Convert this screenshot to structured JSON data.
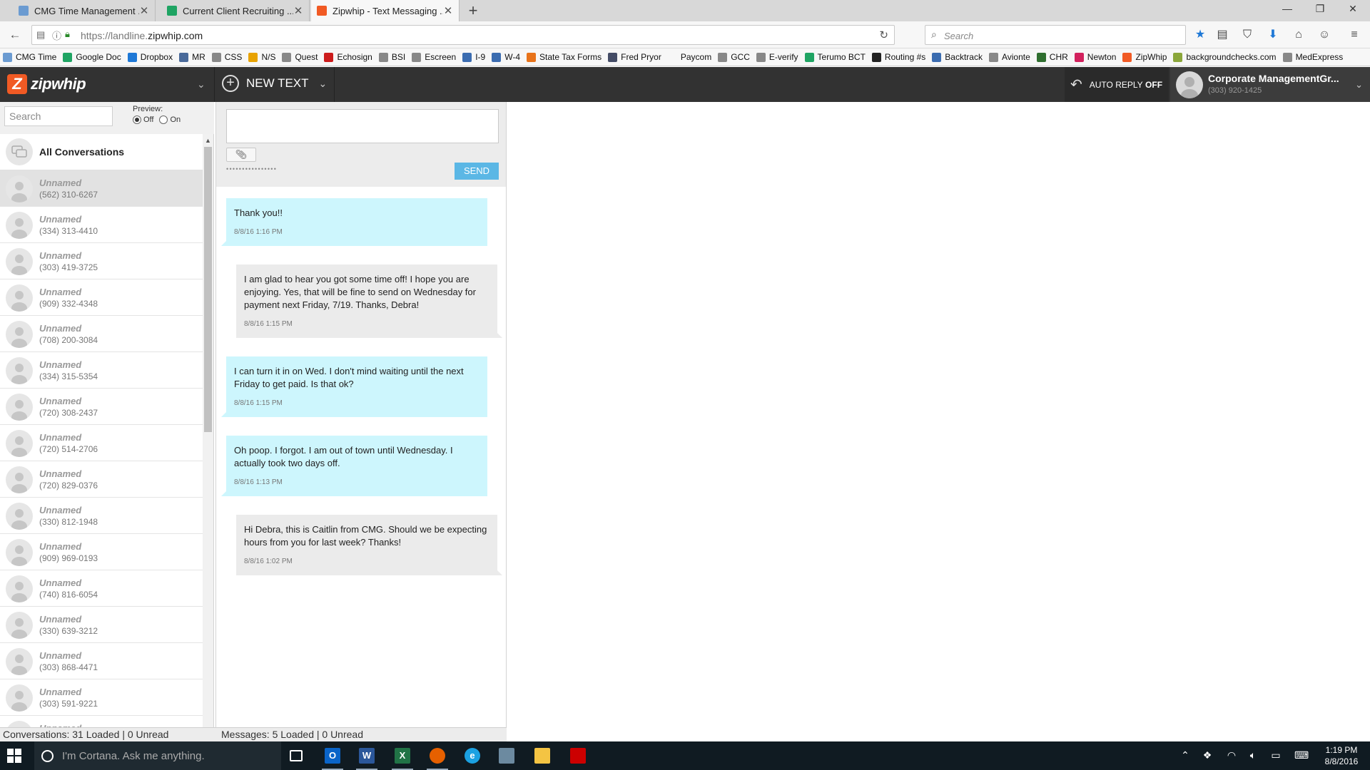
{
  "browser": {
    "tabs": [
      {
        "label": "CMG Time Management ...",
        "color": "#6b9bd1",
        "active": false
      },
      {
        "label": "Current Client Recruiting ...",
        "color": "#1fa463",
        "active": false
      },
      {
        "label": "Zipwhip - Text Messaging ...",
        "color": "#f15a24",
        "active": true
      }
    ],
    "url_prefix": "https://landline.",
    "url_domain": "zipwhip.com",
    "search_placeholder": "Search",
    "bookmarks": [
      {
        "label": "CMG Time",
        "color": "#6b9bd1"
      },
      {
        "label": "Google Doc",
        "color": "#1fa463"
      },
      {
        "label": "Dropbox",
        "color": "#1e78d6"
      },
      {
        "label": "MR",
        "color": "#4a6a9a"
      },
      {
        "label": "CSS",
        "color": "#888888"
      },
      {
        "label": "N/S",
        "color": "#e8a200"
      },
      {
        "label": "Quest",
        "color": "#888888"
      },
      {
        "label": "Echosign",
        "color": "#cc1c1c"
      },
      {
        "label": "BSI",
        "color": "#888888"
      },
      {
        "label": "Escreen",
        "color": "#888888"
      },
      {
        "label": "I-9",
        "color": "#3b6cb0"
      },
      {
        "label": "W-4",
        "color": "#3b6cb0"
      },
      {
        "label": "State Tax Forms",
        "color": "#e8731a"
      },
      {
        "label": "Fred Pryor",
        "color": "#444c66"
      },
      {
        "label": "Paycom",
        "color": "#f7f7f7"
      },
      {
        "label": "GCC",
        "color": "#888888"
      },
      {
        "label": "E-verify",
        "color": "#888888"
      },
      {
        "label": "Terumo BCT",
        "color": "#1fa463"
      },
      {
        "label": "Routing #s",
        "color": "#222222"
      },
      {
        "label": "Backtrack",
        "color": "#3b6cb0"
      },
      {
        "label": "Avionte",
        "color": "#888888"
      },
      {
        "label": "CHR",
        "color": "#2f6e2f"
      },
      {
        "label": "Newton",
        "color": "#d2215d"
      },
      {
        "label": "ZipWhip",
        "color": "#f15a24"
      },
      {
        "label": "backgroundchecks.com",
        "color": "#8aa63a"
      },
      {
        "label": "MedExpress",
        "color": "#888888"
      }
    ]
  },
  "app": {
    "brand": "zipwhip",
    "new_text_label": "NEW TEXT",
    "auto_reply_label": "AUTO REPLY",
    "auto_reply_state": "OFF",
    "account_name": "Corporate ManagementGr...",
    "account_phone": "(303) 920-1425"
  },
  "sidebar": {
    "search_placeholder": "Search",
    "preview_label": "Preview:",
    "preview_off": "Off",
    "preview_on": "On",
    "all_conversations": "All Conversations",
    "conversations": [
      {
        "name": "Unnamed",
        "phone": "(562) 310-6267",
        "selected": true
      },
      {
        "name": "Unnamed",
        "phone": "(334) 313-4410"
      },
      {
        "name": "Unnamed",
        "phone": "(303) 419-3725"
      },
      {
        "name": "Unnamed",
        "phone": "(909) 332-4348"
      },
      {
        "name": "Unnamed",
        "phone": "(708) 200-3084"
      },
      {
        "name": "Unnamed",
        "phone": "(334) 315-5354"
      },
      {
        "name": "Unnamed",
        "phone": "(720) 308-2437"
      },
      {
        "name": "Unnamed",
        "phone": "(720) 514-2706"
      },
      {
        "name": "Unnamed",
        "phone": "(720) 829-0376"
      },
      {
        "name": "Unnamed",
        "phone": "(330) 812-1948"
      },
      {
        "name": "Unnamed",
        "phone": "(909) 969-0193"
      },
      {
        "name": "Unnamed",
        "phone": "(740) 816-6054"
      },
      {
        "name": "Unnamed",
        "phone": "(330) 639-3212"
      },
      {
        "name": "Unnamed",
        "phone": "(303) 868-4471"
      },
      {
        "name": "Unnamed",
        "phone": "(303) 591-9221"
      },
      {
        "name": "Unnamed",
        "phone": ""
      }
    ]
  },
  "compose": {
    "value": "",
    "send_label": "SEND",
    "dots": "••••••••••••••••"
  },
  "messages": [
    {
      "direction": "in",
      "text": "Thank you!!",
      "time": "8/8/16 1:16 PM"
    },
    {
      "direction": "out",
      "text": "I am glad to hear you got some time off! I hope you are enjoying. Yes, that will be fine to send on Wednesday for payment next Friday, 7/19. Thanks, Debra!",
      "time": "8/8/16 1:15 PM"
    },
    {
      "direction": "in",
      "text": "I can turn it in on Wed. I don't mind waiting until the next Friday to get paid. Is that ok?",
      "time": "8/8/16 1:15 PM"
    },
    {
      "direction": "in",
      "text": "Oh poop. I forgot. I am out of town until Wednesday. I actually took two days off.",
      "time": "8/8/16 1:13 PM"
    },
    {
      "direction": "out",
      "text": "Hi Debra, this is Caitlin from CMG. Should we be expecting hours from you for last week? Thanks!",
      "time": "8/8/16 1:02 PM"
    }
  ],
  "status": {
    "conversations": "Conversations: 31 Loaded | 0 Unread",
    "messages": "Messages: 5 Loaded | 0 Unread"
  },
  "taskbar": {
    "cortana_placeholder": "I'm Cortana. Ask me anything.",
    "time": "1:19 PM",
    "date": "8/8/2016",
    "apps": [
      {
        "name": "task-view-icon",
        "label": "",
        "color": "transparent"
      },
      {
        "name": "outlook-icon",
        "label": "O",
        "color": "#0a64c8"
      },
      {
        "name": "word-icon",
        "label": "W",
        "color": "#2b579a"
      },
      {
        "name": "excel-icon",
        "label": "X",
        "color": "#217346"
      },
      {
        "name": "firefox-icon",
        "label": "",
        "color": "#e66000"
      },
      {
        "name": "ie-icon",
        "label": "e",
        "color": "#1ba1e2"
      },
      {
        "name": "tool-icon",
        "label": "",
        "color": "#6c8aa0"
      },
      {
        "name": "file-explorer-icon",
        "label": "",
        "color": "#f4c443"
      },
      {
        "name": "acrobat-icon",
        "label": "",
        "color": "#cc0000"
      }
    ]
  }
}
